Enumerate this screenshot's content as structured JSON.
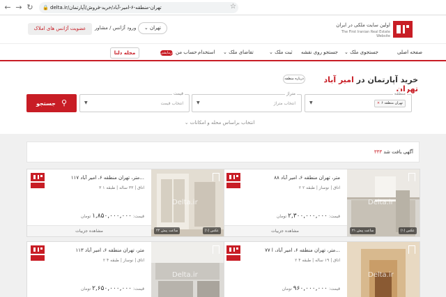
{
  "browser": {
    "url": "delta.ir/تهران-منطقه-۶-امیر-آباد/خرید-فروش/آپارتمان",
    "url_domain": "delta.ir"
  },
  "header": {
    "tagline_fa": "اولین سایت ملکی در ایران",
    "tagline_en": "The First Iranian Real Estate Website",
    "city": "تهران",
    "login": "ورود آژانس / مشاور",
    "agency_button": "عضویت آژانس های املاک"
  },
  "nav": {
    "items": [
      "صفحه اصلی",
      "جستجوی ملک",
      "جستجو روی نقشه",
      "ثبت ملک",
      "تقاضای ملک",
      "استخدام",
      "حساب من"
    ],
    "new_badge": "آزمایشی",
    "magazine": "مجله دلتا"
  },
  "search": {
    "heading_prefix": "خرید آپارتمان در",
    "heading_location": "امیر آباد تهران",
    "about_area": "درباره منطقه",
    "region_label": "منطقه",
    "region_tag": "تهران منطقه ۶",
    "meter_label": "متراژ",
    "meter_placeholder": "انتخاب متراژ",
    "price_label": "قیمت",
    "price_placeholder": "انتخاب قیمت",
    "search_button": "جستجو",
    "filter_link": "انتخاب براساس محله و امکانات"
  },
  "results": {
    "count": "۳۳۳",
    "count_suffix": "آگهی یافت شد"
  },
  "listings": [
    {
      "title": "۸۸ متر، تهران منطقه ۶، امیر آباد",
      "rooms": "۲ اتاق",
      "age": "نوساز",
      "floor": "طبقه ۲",
      "price": "۲,۳۰۰,۰۰۰,۰۰۰",
      "currency": "تومان",
      "price_label": "قیمت:",
      "photo_badge": "عکس (۱)",
      "time": "۲۱ ساعت پیش",
      "details": "مشاهده جزییات"
    },
    {
      "title": "۱۱۷ متر، تهران منطقه ۶، امیر آباد...",
      "rooms": "۳ اتاق",
      "age": "۳۳ ساله",
      "floor": "طبقه ۱",
      "price": "۱,۸۵۰,۰۰۰,۰۰۰",
      "currency": "تومان",
      "price_label": "قیمت:",
      "photo_badge": "عکس (۱)",
      "time": "۲۲ ساعت پیش",
      "details": "مشاهده جزییات"
    },
    {
      "title": "۷۷ متر، تهران منطقه ۶، امیر آباد، ا...",
      "rooms": "۲ اتاق",
      "age": "۱۹ ساله",
      "floor": "طبقه ۴",
      "price": "۹۶۰,۰۰۰,۰۰۰",
      "currency": "تومان",
      "price_label": "قیمت:",
      "photo_badge": "",
      "time": "",
      "details": ""
    },
    {
      "title": "۱۱۳ متر، تهران منطقه ۶، امیر آباد",
      "rooms": "۲ اتاق",
      "age": "نوساز",
      "floor": "طبقه ۴",
      "price": "۲,۶۵۰,۰۰۰,۰۰۰",
      "currency": "تومان",
      "price_label": "قیمت:",
      "photo_badge": "",
      "time": "",
      "details": ""
    }
  ],
  "watermark": "Delta.ir",
  "colors": {
    "brand": "#c81d25"
  }
}
